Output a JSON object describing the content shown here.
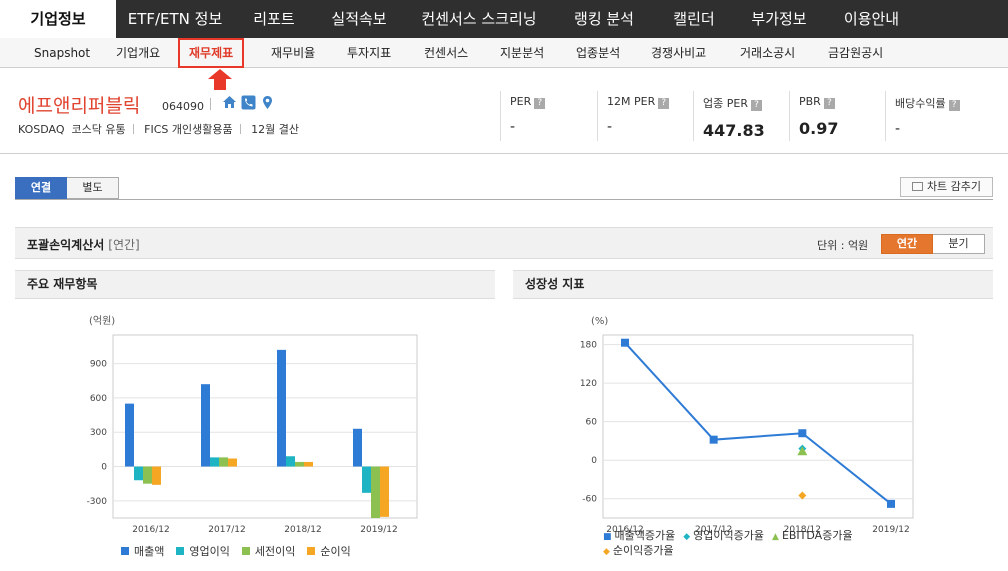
{
  "topnav": [
    "기업정보",
    "ETF/ETN 정보",
    "리포트",
    "실적속보",
    "컨센서스 스크리닝",
    "랭킹 분석",
    "캘린더",
    "부가정보",
    "이용안내"
  ],
  "subnav": [
    "Snapshot",
    "기업개요",
    "재무제표",
    "재무비율",
    "투자지표",
    "컨센서스",
    "지분분석",
    "업종분석",
    "경쟁사비교",
    "거래소공시",
    "금감원공시"
  ],
  "subnav_active_index": 2,
  "company": {
    "name": "에프앤리퍼블릭",
    "code": "064090",
    "market": "KOSDAQ",
    "sector": "코스닥 유통",
    "fics": "FICS 개인생활용품",
    "fiscal": "12월 결산",
    "icons": [
      "home-icon",
      "phone-icon",
      "location-pin-icon"
    ]
  },
  "metrics": [
    {
      "label": "PER",
      "value": "-"
    },
    {
      "label": "12M PER",
      "value": "-"
    },
    {
      "label": "업종 PER",
      "value": "447.83"
    },
    {
      "label": "PBR",
      "value": "0.97"
    },
    {
      "label": "배당수익률",
      "value": "-"
    }
  ],
  "consolidation_tabs": [
    "연결",
    "별도"
  ],
  "hide_chart_label": "차트 감추기",
  "statement": {
    "title": "포괄손익계산서",
    "period_note": "[연간]",
    "unit_label": "단위 : 억원",
    "period_buttons": [
      "연간",
      "분기"
    ]
  },
  "colors": {
    "accent_red": "#e8382a",
    "brand_blue": "#3a6fc0",
    "orange": "#e5762e",
    "series_revenue": "#2e7bd6",
    "series_operating": "#1fb4c4",
    "series_pretax": "#8cc152",
    "series_net": "#f5a623"
  },
  "chart_data": [
    {
      "type": "bar",
      "panel_title": "주요 재무항목",
      "ylabel": "(억원)",
      "categories": [
        "2016/12",
        "2017/12",
        "2018/12",
        "2019/12"
      ],
      "ylim": [
        -450,
        1150
      ],
      "yticks": [
        -300,
        0,
        300,
        600,
        900
      ],
      "series": [
        {
          "name": "매출액",
          "values": [
            550,
            720,
            1020,
            330
          ]
        },
        {
          "name": "영업이익",
          "values": [
            -120,
            80,
            90,
            -230
          ]
        },
        {
          "name": "세전이익",
          "values": [
            -150,
            80,
            40,
            -450
          ]
        },
        {
          "name": "순이익",
          "values": [
            -160,
            70,
            40,
            -440
          ]
        }
      ],
      "grid": true,
      "legend": "bottom"
    },
    {
      "type": "line",
      "panel_title": "성장성 지표",
      "ylabel": "(%)",
      "categories": [
        "2016/12",
        "2017/12",
        "2018/12",
        "2019/12"
      ],
      "ylim": [
        -90,
        195
      ],
      "yticks": [
        -60,
        0,
        60,
        120,
        180
      ],
      "series": [
        {
          "name": "매출액증가율",
          "values": [
            183,
            32,
            42,
            -68
          ]
        },
        {
          "name": "영업이익증가율",
          "values": [
            null,
            null,
            18,
            null
          ]
        },
        {
          "name": "EBITDA증가율",
          "values": [
            null,
            null,
            14,
            null
          ]
        },
        {
          "name": "순이익증가율",
          "values": [
            null,
            null,
            -55,
            null
          ]
        }
      ],
      "grid": true,
      "legend": "bottom"
    }
  ]
}
